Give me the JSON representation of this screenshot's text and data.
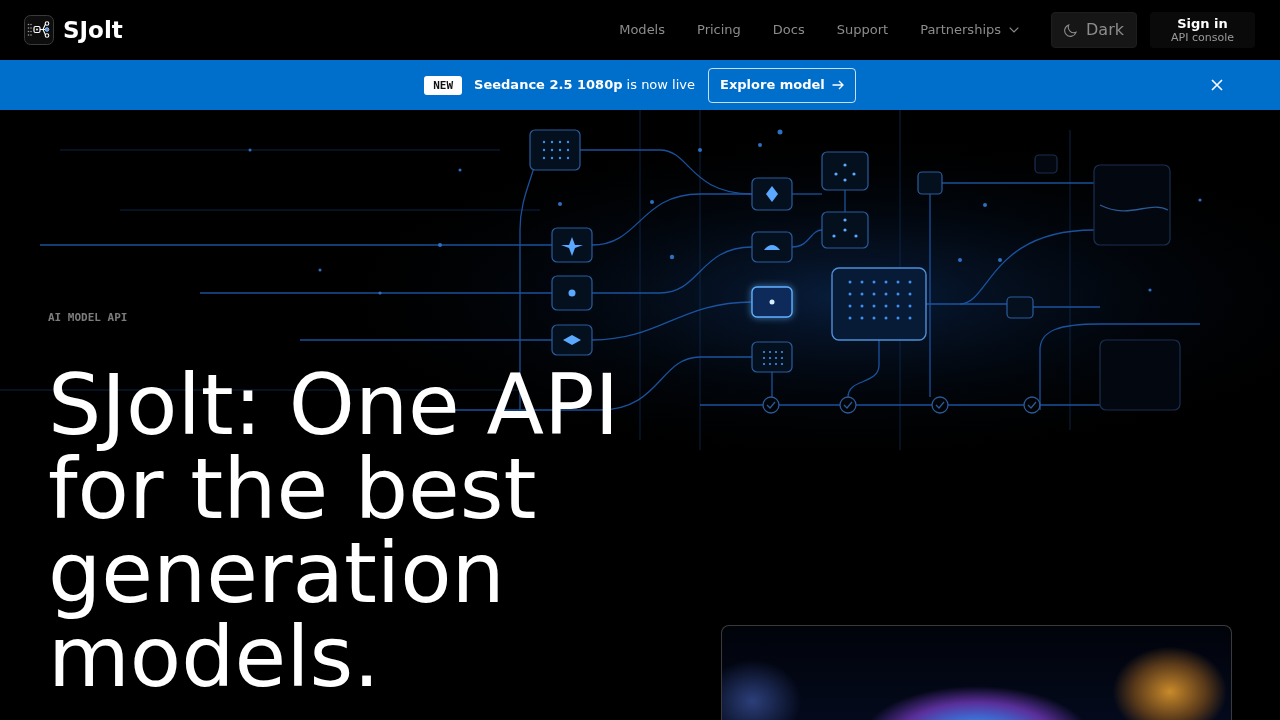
{
  "navbar": {
    "brand": "SJolt",
    "links": [
      {
        "label": "Models",
        "kind": "link"
      },
      {
        "label": "Pricing",
        "kind": "link"
      },
      {
        "label": "Docs",
        "kind": "link"
      },
      {
        "label": "Support",
        "kind": "link"
      },
      {
        "label": "Partnerships",
        "kind": "dropdown"
      }
    ],
    "theme_toggle": {
      "label": "Dark"
    },
    "sign_in": {
      "label": "Sign in",
      "sublabel": "API console"
    }
  },
  "announcement": {
    "badge": "NEW",
    "message": "**Seedance 2.5 1080p** is now live",
    "button": "Explore model"
  },
  "hero": {
    "eyebrow": "AI MODEL API",
    "headline": "SJolt: One API for the best generation models."
  }
}
